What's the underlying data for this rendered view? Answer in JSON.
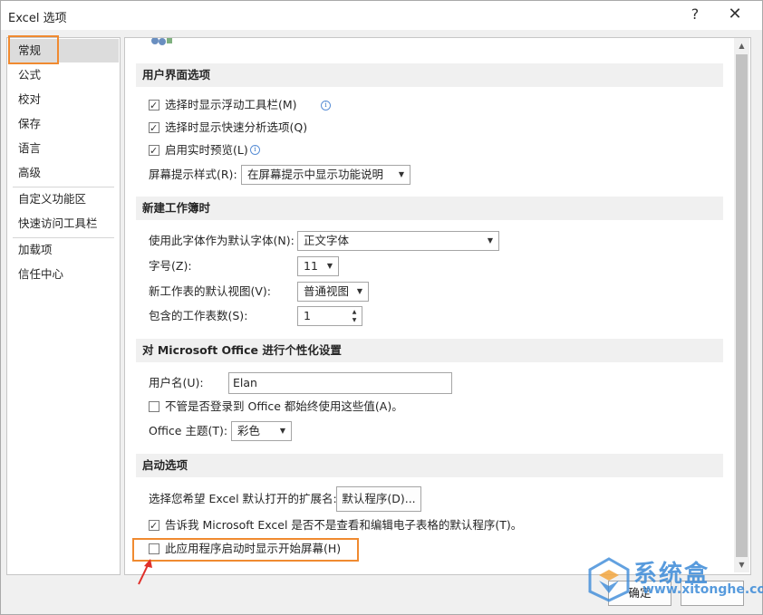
{
  "window": {
    "title": "Excel 选项",
    "help": "?",
    "close": "✕"
  },
  "nav": {
    "items": [
      {
        "label": "常规"
      },
      {
        "label": "公式"
      },
      {
        "label": "校对"
      },
      {
        "label": "保存"
      },
      {
        "label": "语言"
      },
      {
        "label": "高级"
      },
      {
        "label": "自定义功能区"
      },
      {
        "label": "快速访问工具栏"
      },
      {
        "label": "加载项"
      },
      {
        "label": "信任中心"
      }
    ],
    "selected": "常规"
  },
  "sections": {
    "ui": {
      "header": "用户界面选项",
      "mini_toolbar": {
        "label": "选择时显示浮动工具栏(M)",
        "checked": true
      },
      "quick_analysis": {
        "label": "选择时显示快速分析选项(Q)",
        "checked": true
      },
      "live_preview": {
        "label": "启用实时预览(L)",
        "checked": true
      },
      "screentip_label": "屏幕提示样式(R):",
      "screentip_value": "在屏幕提示中显示功能说明"
    },
    "new_workbook": {
      "header": "新建工作簿时",
      "font_label": "使用此字体作为默认字体(N):",
      "font_value": "正文字体",
      "size_label": "字号(Z):",
      "size_value": "11",
      "view_label": "新工作表的默认视图(V):",
      "view_value": "普通视图",
      "sheets_label": "包含的工作表数(S):",
      "sheets_value": "1"
    },
    "personalize": {
      "header": "对 Microsoft Office 进行个性化设置",
      "username_label": "用户名(U):",
      "username_value": "Elan",
      "always_use": {
        "label": "不管是否登录到 Office 都始终使用这些值(A)。",
        "checked": false
      },
      "theme_label": "Office 主题(T):",
      "theme_value": "彩色"
    },
    "startup": {
      "header": "启动选项",
      "ext_label": "选择您希望 Excel 默认打开的扩展名:",
      "default_programs_button": "默认程序(D)...",
      "tell_me": {
        "label": "告诉我 Microsoft Excel 是否不是查看和编辑电子表格的默认程序(T)。",
        "checked": true
      },
      "start_screen": {
        "label": "此应用程序启动时显示开始屏幕(H)",
        "checked": false
      }
    }
  },
  "footer": {
    "ok": "确定"
  },
  "watermark": {
    "text": "系统盒",
    "url": "www.xitonghe.com"
  },
  "colors": {
    "highlight": "#f08a30",
    "arrow": "#e0302a",
    "selected_nav": "#dcdcdc"
  }
}
